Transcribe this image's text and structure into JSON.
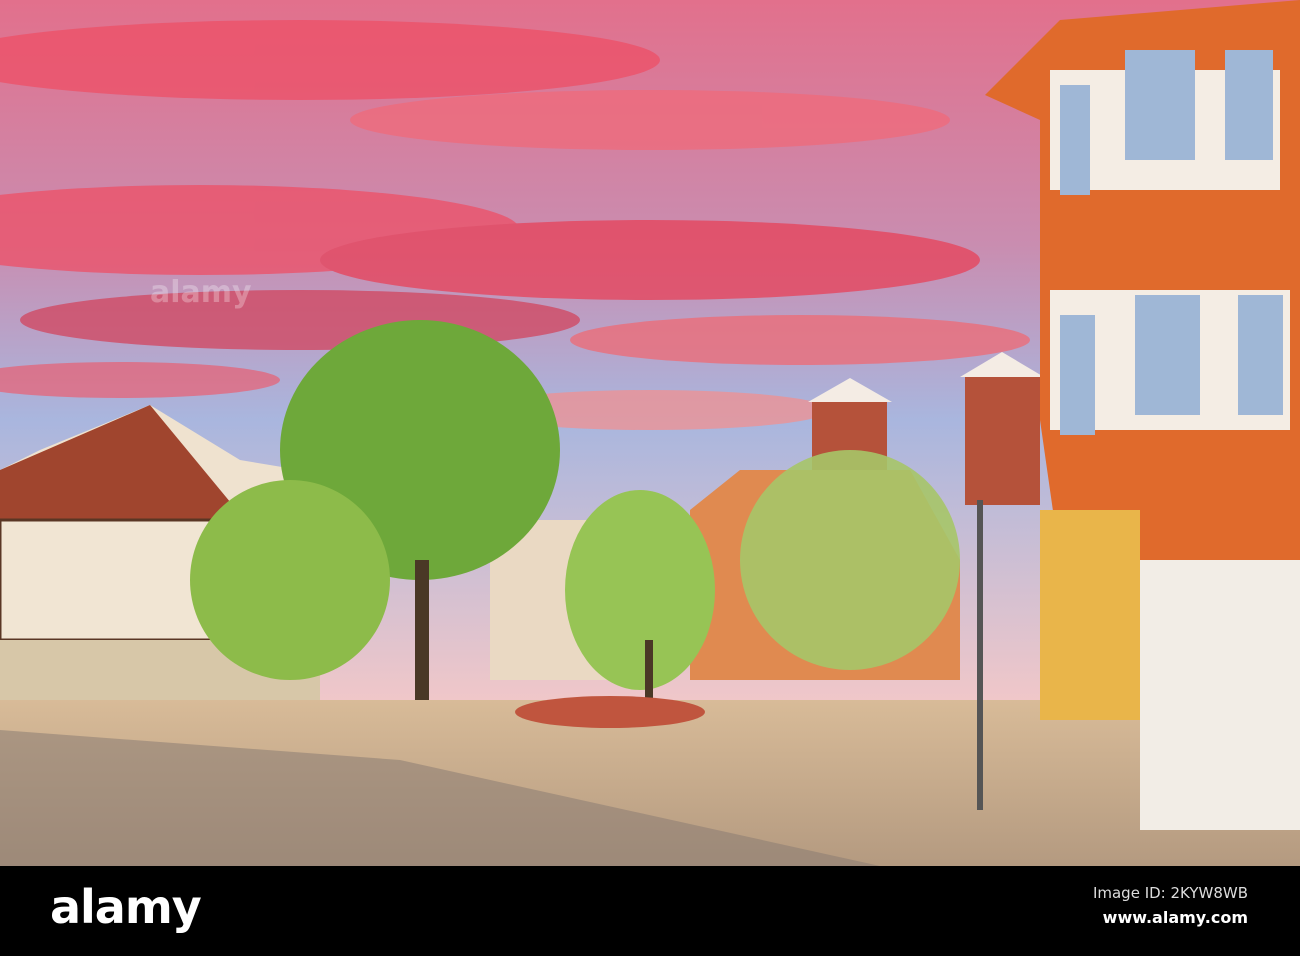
{
  "photo": {
    "subject": "town-square",
    "colors": {
      "sky_top": "#e86a8a",
      "sky_mid": "#9fb2dc",
      "cloud": "#ef4f63",
      "tree": "#6fa83a",
      "building_orange": "#e0692c",
      "ground": "#c9ad8c",
      "bar": "#000000"
    }
  },
  "watermark": {
    "text": "alamy"
  },
  "footer": {
    "logo": "alamy",
    "image_id": "Image ID: 2KYW8WB",
    "url": "www.alamy.com"
  }
}
